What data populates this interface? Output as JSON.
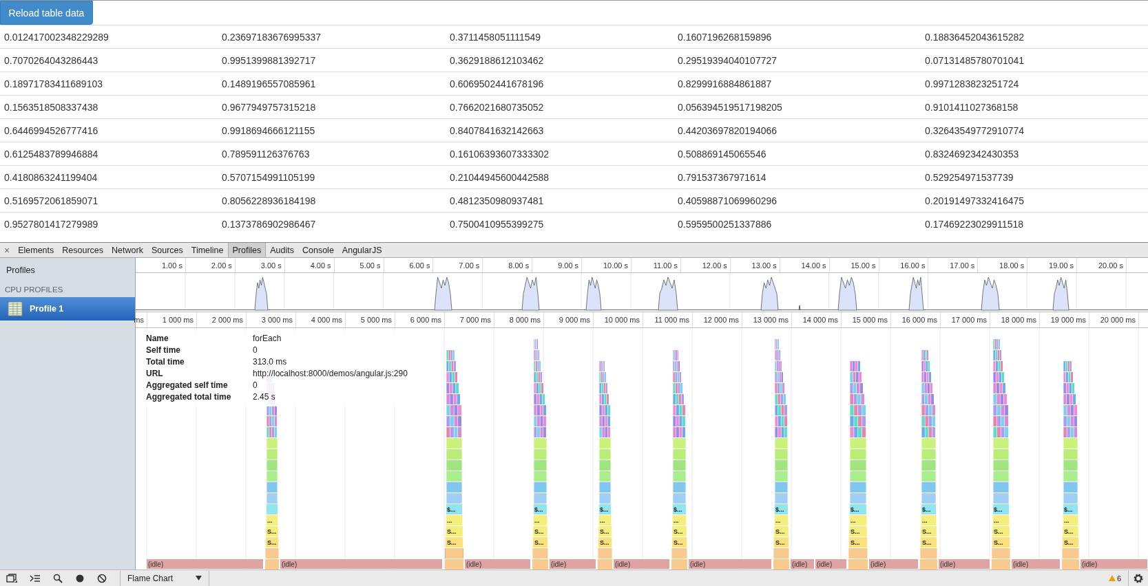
{
  "page": {
    "reload_button": "Reload table data",
    "table": {
      "rows": [
        [
          "0.012417002348229289",
          "0.23697183676995337",
          "0.3711458051111549",
          "0.1607196268159896",
          "0.18836452043615282"
        ],
        [
          "0.7070264043286443",
          "0.9951399881392717",
          "0.3629188612103462",
          "0.29519394040107727",
          "0.07131485780701041"
        ],
        [
          "0.18971783411689103",
          "0.1489196557085961",
          "0.6069502441678196",
          "0.8299916884861887",
          "0.9971283823251724"
        ],
        [
          "0.1563518508337438",
          "0.9677949757315218",
          "0.7662021680735052",
          "0.056394519517198205",
          "0.9101411027368158"
        ],
        [
          "0.6446994526777416",
          "0.9918694666121155",
          "0.8407841632142663",
          "0.44203697820194066",
          "0.32643549772910774"
        ],
        [
          "0.6125483789946884",
          "0.789591126376763",
          "0.16106393607333302",
          "0.508869145065546",
          "0.8324692342430353"
        ],
        [
          "0.4180863241199404",
          "0.5707154991105199",
          "0.21044945600442588",
          "0.791537367971614",
          "0.529254971537739"
        ],
        [
          "0.5169572061859071",
          "0.8056228936184198",
          "0.4812350980937481",
          "0.40598871069960296",
          "0.20191497332416475"
        ],
        [
          "0.9527801417279989",
          "0.1373786902986467",
          "0.7500410955399275",
          "0.5959500251337886",
          "0.17469223029911518"
        ]
      ]
    }
  },
  "devtools": {
    "close": "×",
    "tabs": [
      {
        "label": "Elements",
        "selected": false
      },
      {
        "label": "Resources",
        "selected": false
      },
      {
        "label": "Network",
        "selected": false
      },
      {
        "label": "Sources",
        "selected": false
      },
      {
        "label": "Timeline",
        "selected": false
      },
      {
        "label": "Profiles",
        "selected": true
      },
      {
        "label": "Audits",
        "selected": false
      },
      {
        "label": "Console",
        "selected": false
      },
      {
        "label": "AngularJS",
        "selected": false
      }
    ],
    "sidebar": {
      "title": "Profiles",
      "section": "CPU PROFILES",
      "items": [
        {
          "label": "Profile 1",
          "selected": true
        }
      ]
    },
    "overview_ruler": [
      "1.00 s",
      "2.00 s",
      "3.00 s",
      "4.00 s",
      "5.00 s",
      "6.00 s",
      "7.00 s",
      "8.00 s",
      "9.00 s",
      "10.00 s",
      "11.00 s",
      "12.00 s",
      "13.00 s",
      "14.00 s",
      "15.00 s",
      "16.00 s",
      "17.00 s",
      "18.00 s",
      "19.00 s",
      "20.00 s"
    ],
    "flame_ruler": [
      "ms",
      "1 000 ms",
      "2 000 ms",
      "3 000 ms",
      "4 000 ms",
      "5 000 ms",
      "6 000 ms",
      "7 000 ms",
      "8 000 ms",
      "9 000 ms",
      "10 000 ms",
      "11 000 ms",
      "12 000 ms",
      "13 000 ms",
      "14 000 ms",
      "15 000 ms",
      "16 000 ms",
      "17 000 ms",
      "18 000 ms",
      "19 000 ms",
      "20 000 ms"
    ],
    "tooltip": [
      {
        "label": "Name",
        "value": "forEach"
      },
      {
        "label": "Self time",
        "value": "0"
      },
      {
        "label": "Total time",
        "value": "313.0 ms"
      },
      {
        "label": "URL",
        "value": "http://localhost:8000/demos/angular.js:290"
      },
      {
        "label": "Aggregated self time",
        "value": "0"
      },
      {
        "label": "Aggregated total time",
        "value": "2.45 s"
      }
    ],
    "flame_chart": {
      "idle_labels": [
        "(idle)",
        "(idle)",
        "(idle)",
        "(idle)",
        "(idle)",
        "(idle)",
        "(idle)",
        "(idle)",
        "(idle)",
        "(idle)",
        "(idle)",
        "(idle)"
      ],
      "burst_labels": [
        [
          "...",
          "S...",
          "S..."
        ],
        [
          "$...",
          "...",
          "S...",
          "S..."
        ],
        [
          "$...",
          "...",
          "S...",
          "S..."
        ],
        [
          "$...",
          "...",
          "S...",
          "S..."
        ],
        [
          "$...",
          "...",
          "S...",
          "S..."
        ],
        [
          "$...",
          "...",
          "S...",
          "S..."
        ],
        [
          "$...",
          "...",
          "S...",
          "S..."
        ],
        [
          "$...",
          "...",
          "S...",
          "S..."
        ],
        [
          "$...",
          "...",
          "S...",
          "S..."
        ],
        [
          "$...",
          "...",
          "S...",
          "S..."
        ]
      ]
    },
    "bottom_bar": {
      "view_select": "Flame Chart",
      "warning_count": "6"
    }
  }
}
